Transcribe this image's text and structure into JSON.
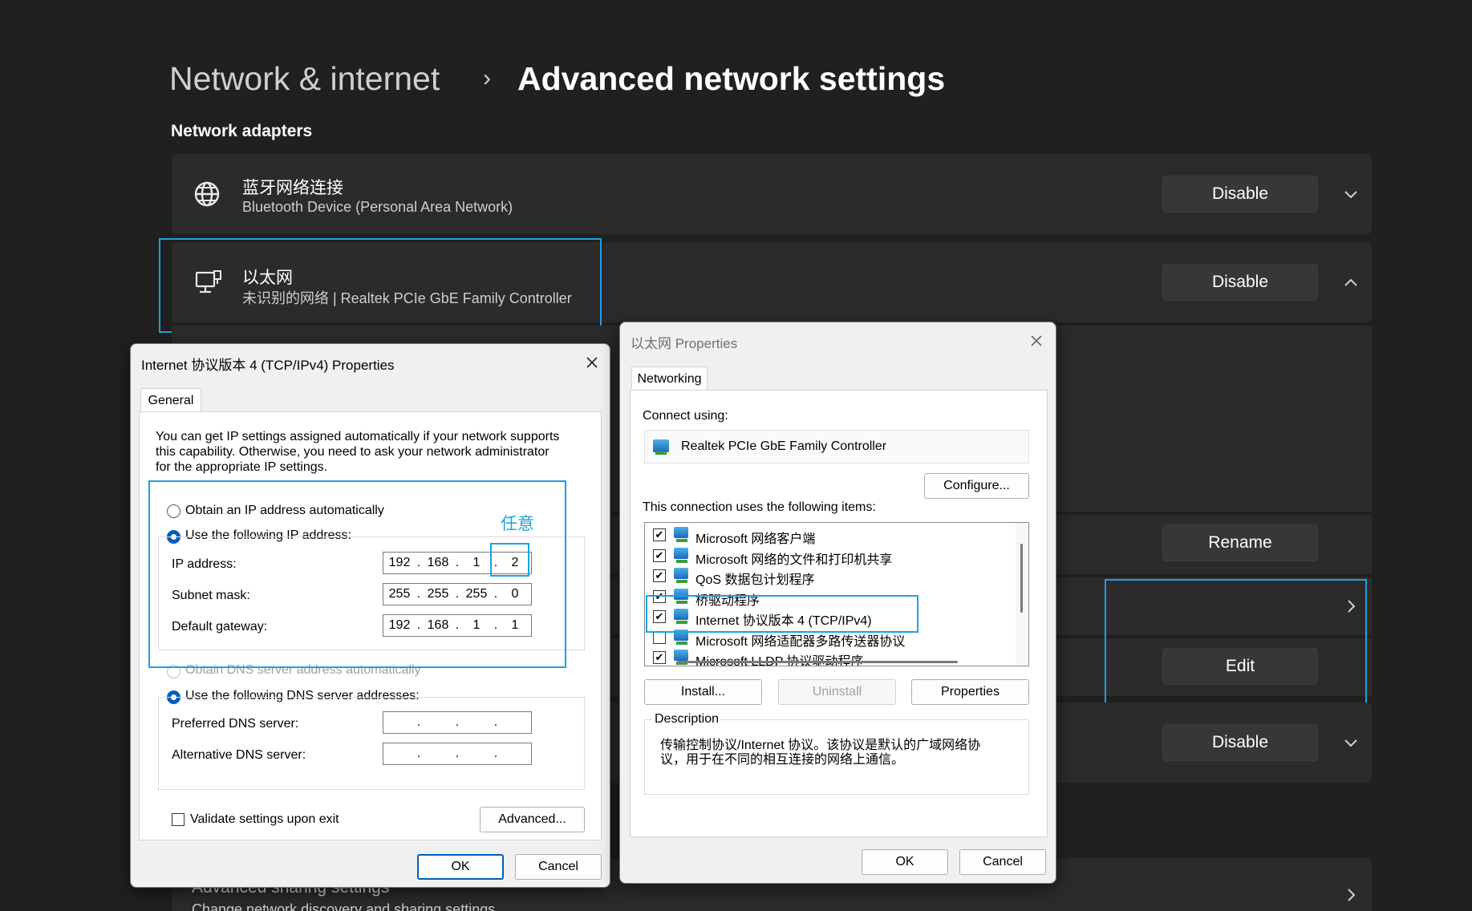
{
  "breadcrumb": {
    "parent": "Network & internet",
    "separator": "›",
    "current": "Advanced network settings"
  },
  "section_title": "Network adapters",
  "adapters": [
    {
      "name": "蓝牙网络连接",
      "description": "Bluetooth Device (Personal Area Network)",
      "button": "Disable",
      "chevron": "chevron-down-icon"
    },
    {
      "name": "以太网",
      "description": "未识别的网络 | Realtek PCIe GbE Family Controller",
      "button": "Disable",
      "chevron": "chevron-up-icon"
    },
    {
      "button": "Disable",
      "chevron": "chevron-down-icon"
    }
  ],
  "ethernet_actions": {
    "rename": "Rename",
    "edit": "Edit"
  },
  "advanced_sharing": {
    "title": "Advanced sharing settings",
    "subtitle": "Change network discovery and sharing settings"
  },
  "ipv4_dialog": {
    "title": "Internet 协议版本 4 (TCP/IPv4) Properties",
    "tab": "General",
    "intro": [
      "You can get IP settings assigned automatically if your network supports",
      "this capability. Otherwise, you need to ask your network administrator",
      "for the appropriate IP settings."
    ],
    "auto_ip": "Obtain an IP address automatically",
    "manual_ip": "Use the following IP address:",
    "ip_label": "IP address:",
    "ip": [
      "192",
      "168",
      "1",
      "2"
    ],
    "mask_label": "Subnet mask:",
    "mask": [
      "255",
      "255",
      "255",
      "0"
    ],
    "gateway_label": "Default gateway:",
    "gateway": [
      "192",
      "168",
      "1",
      "1"
    ],
    "auto_dns": "Obtain DNS server address automatically",
    "manual_dns": "Use the following DNS server addresses:",
    "preferred_dns_label": "Preferred DNS server:",
    "alternate_dns_label": "Alternative DNS server:",
    "validate": "Validate settings upon exit",
    "advanced": "Advanced...",
    "ok": "OK",
    "cancel": "Cancel"
  },
  "eth_dialog": {
    "title": "以太网 Properties",
    "tab": "Networking",
    "connect_using": "Connect using:",
    "adapter": "Realtek PCIe GbE Family Controller",
    "configure": "Configure...",
    "items_label": "This connection uses the following items:",
    "items": [
      {
        "label": "Microsoft 网络客户端",
        "checked": true
      },
      {
        "label": "Microsoft 网络的文件和打印机共享",
        "checked": true
      },
      {
        "label": "QoS 数据包计划程序",
        "checked": true
      },
      {
        "label": "桥驱动程序",
        "checked": true
      },
      {
        "label": "Internet 协议版本 4 (TCP/IPv4)",
        "checked": true
      },
      {
        "label": "Microsoft 网络适配器多路传送器协议",
        "checked": false
      },
      {
        "label": "Microsoft LLDP 协议驱动程序",
        "checked": true
      }
    ],
    "install": "Install...",
    "uninstall": "Uninstall",
    "properties": "Properties",
    "description_label": "Description",
    "description": [
      "传输控制协议/Internet 协议。该协议是默认的广域网络协",
      "议，用于在不同的相互连接的网络上通信。"
    ],
    "ok": "OK",
    "cancel": "Cancel"
  },
  "annotation": {
    "note": "任意"
  },
  "colors": {
    "background": "#202020",
    "card": "#2b2b2b",
    "highlight": "#1ea1e0",
    "accent": "#005fb8"
  }
}
